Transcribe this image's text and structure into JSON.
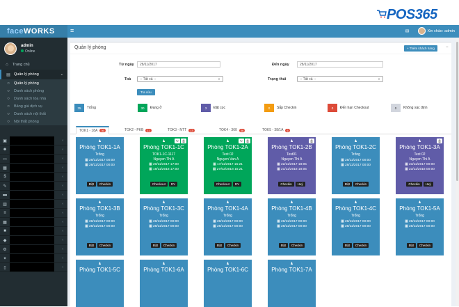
{
  "brand": {
    "logo_text": "POS365"
  },
  "sidebar": {
    "logo_prefix": "face",
    "logo_suffix": "WORKS",
    "user_name": "admin",
    "user_status": "Online",
    "items": [
      {
        "label": "Trang chủ",
        "icon": "home-icon"
      },
      {
        "label": "Quản lý phòng",
        "icon": "folder-icon"
      }
    ],
    "sub_items": [
      "Quản lý phòng",
      "Danh sách phòng",
      "Danh sách tòa nhà",
      "Bảng giá dịch vụ",
      "Danh sách nội thất",
      "Nội thất phòng"
    ]
  },
  "topbar": {
    "greeting": "Xin chào: admin"
  },
  "panel": {
    "title": "Quản lý phòng",
    "add_button": "+ Thêm khách hàng",
    "from_label": "Từ ngày",
    "from_value": "28/11/2017",
    "to_label": "Đến ngày",
    "to_value": "28/11/2017",
    "building_label": "Toà",
    "building_value": "-- Tất cả --",
    "status_label": "Trạng thái",
    "status_value": "-- Tất cả --",
    "search_button": "Tra cứu"
  },
  "legend": [
    {
      "count": "35",
      "label": "Trống",
      "color": "#3c8dbc"
    },
    {
      "count": "30",
      "label": "Đang ở",
      "color": "#00a65a"
    },
    {
      "count": "3",
      "label": "Đặt cọc",
      "color": "#605ca8"
    },
    {
      "count": "0",
      "label": "Sắp Checkin",
      "color": "#f39c12"
    },
    {
      "count": "0",
      "label": "Đến hạn Checkout",
      "color": "#dd4b39"
    },
    {
      "count": "0",
      "label": "Không xác định",
      "color": "#d2d6de"
    }
  ],
  "tabs": [
    {
      "label": "TOK1 - 18A",
      "count": "36"
    },
    {
      "label": "TOK2 - PKB",
      "count": "11"
    },
    {
      "label": "TOK3 - NTT",
      "count": "13"
    },
    {
      "label": "TOK4 - 360",
      "count": "36"
    },
    {
      "label": "TOK5 - 38/1A",
      "count": "6"
    }
  ],
  "rooms": [
    {
      "name": "Phòng TOK1-1A",
      "status": "Trống",
      "line2": "",
      "d1": "28/11/2017 00:00",
      "d2": "28/11/2017 00:00",
      "b1": "Đặt",
      "b2": "Checkin"
    },
    {
      "name": "Phòng TOK1-1C",
      "status": "TOK1-1C-1117",
      "line2": "Nguyen Thi A",
      "d1": "20/11/2017 17:00",
      "d2": "19/11/2018 17:00",
      "b1": "Checkout",
      "b2": "DV"
    },
    {
      "name": "Phòng TOK1-2A",
      "status": "Test 02",
      "line2": "Nguyen Van A",
      "d1": "17/11/2017 15:21",
      "d2": "27/02/2018 15:21",
      "b1": "Checkout",
      "b2": "DV"
    },
    {
      "name": "Phòng TOK1-2B",
      "status": "Test01",
      "line2": "Nguyen Thi A",
      "d1": "22/11/2017 18:05",
      "d2": "21/11/2018 18:05",
      "b1": "Checkin",
      "b2": "Huỷ"
    },
    {
      "name": "Phòng TOK1-2C",
      "status": "Trống",
      "line2": "",
      "d1": "28/11/2017 00:00",
      "d2": "28/11/2017 00:00",
      "b1": "Đặt",
      "b2": "Checkin"
    },
    {
      "name": "Phòng TOK1-3A",
      "status": "Test 02",
      "line2": "Nguyen Thi A",
      "d1": "23/11/2017 00:00",
      "d2": "23/11/2018 00:00",
      "b1": "Checkin",
      "b2": "Huỷ"
    },
    {
      "name": "Phòng TOK1-3B",
      "status": "Trống",
      "line2": "",
      "d1": "28/11/2017 00:00",
      "d2": "28/11/2017 00:00",
      "b1": "Đặt",
      "b2": "Checkin"
    },
    {
      "name": "Phòng TOK1-3C",
      "status": "Trống",
      "line2": "",
      "d1": "28/11/2017 00:00",
      "d2": "28/11/2017 00:00",
      "b1": "Đặt",
      "b2": "Checkin"
    },
    {
      "name": "Phòng TOK1-4A",
      "status": "Trống",
      "line2": "",
      "d1": "28/11/2017 00:00",
      "d2": "28/11/2017 00:00",
      "b1": "Đặt",
      "b2": "Checkin"
    },
    {
      "name": "Phòng TOK1-4B",
      "status": "Trống",
      "line2": "",
      "d1": "28/11/2017 00:00",
      "d2": "28/11/2017 00:00",
      "b1": "Đặt",
      "b2": "Checkin"
    },
    {
      "name": "Phòng TOK1-4C",
      "status": "Trống",
      "line2": "",
      "d1": "28/11/2017 00:00",
      "d2": "28/11/2017 00:00",
      "b1": "Đặt",
      "b2": "Checkin"
    },
    {
      "name": "Phòng TOK1-5A",
      "status": "Trống",
      "line2": "",
      "d1": "28/11/2017 00:00",
      "d2": "28/11/2017 00:00",
      "b1": "Đặt",
      "b2": "Checkin"
    },
    {
      "name": "Phòng TOK1-5C",
      "status": "",
      "line2": "",
      "d1": "",
      "d2": "",
      "b1": "",
      "b2": ""
    },
    {
      "name": "Phòng TOK1-6A",
      "status": "",
      "line2": "",
      "d1": "",
      "d2": "",
      "b1": "",
      "b2": ""
    },
    {
      "name": "Phòng TOK1-6C",
      "status": "",
      "line2": "",
      "d1": "",
      "d2": "",
      "b1": "",
      "b2": ""
    },
    {
      "name": "Phòng TOK1-7A",
      "status": "",
      "line2": "",
      "d1": "",
      "d2": "",
      "b1": "",
      "b2": ""
    }
  ]
}
